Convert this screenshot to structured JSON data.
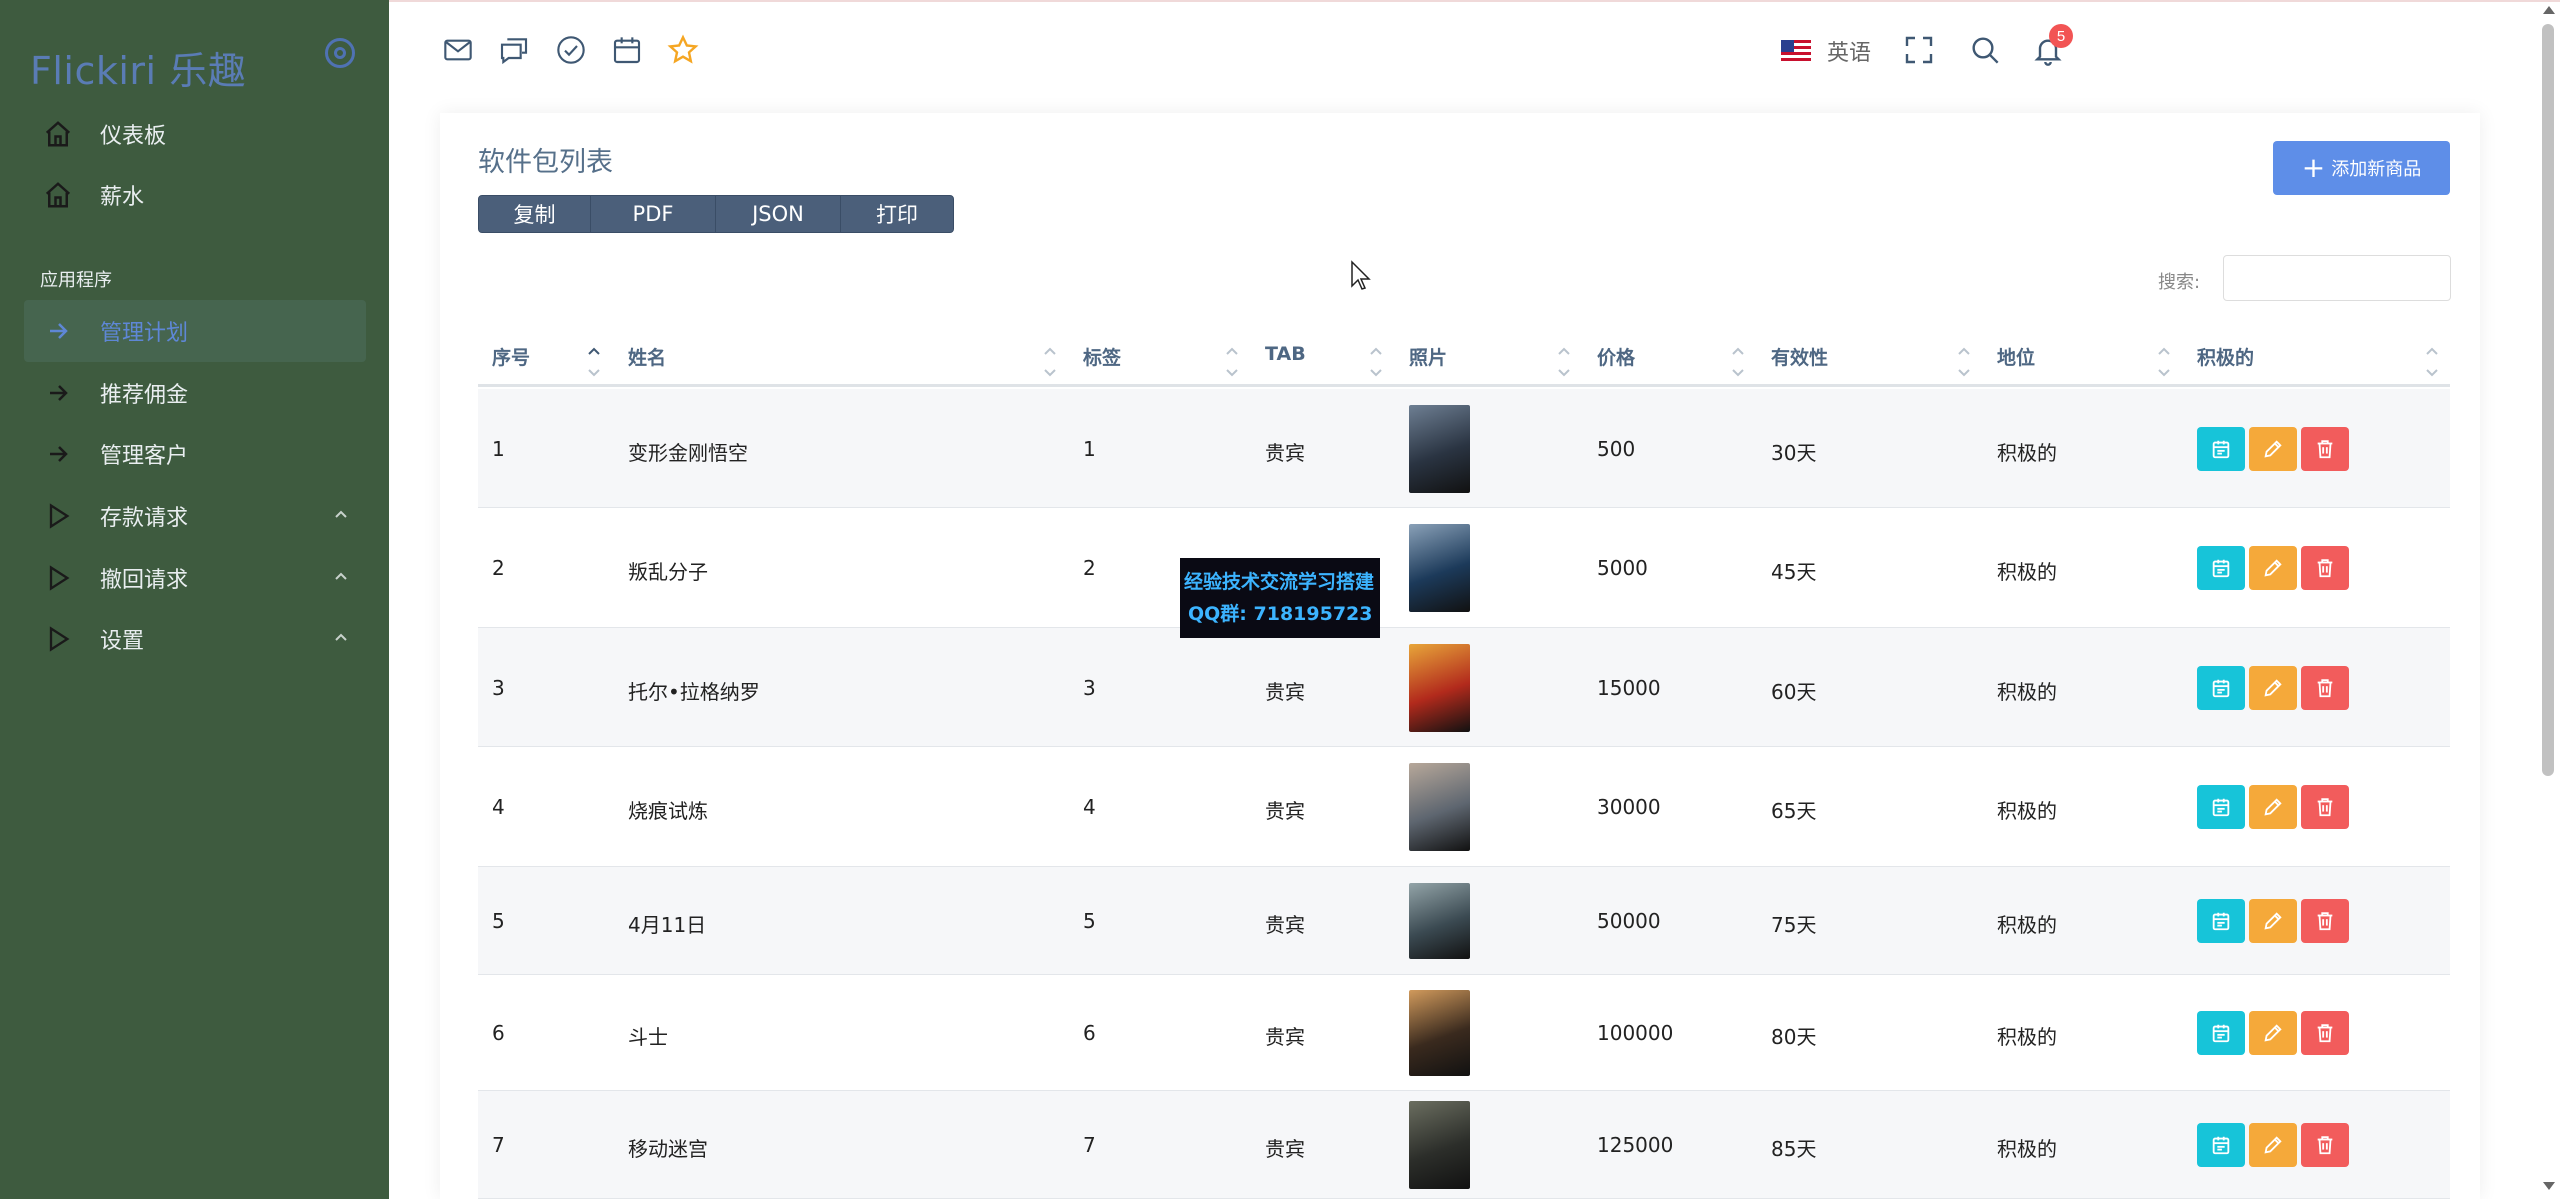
{
  "brand": "Flickiri 乐趣",
  "sidebar": {
    "items": [
      {
        "label": "仪表板",
        "icon": "home-icon"
      },
      {
        "label": "薪水",
        "icon": "home-icon"
      }
    ],
    "section_label": "应用程序",
    "app_items": [
      {
        "label": "管理计划",
        "icon": "arrow-right-icon",
        "active": true
      },
      {
        "label": "推荐佣金",
        "icon": "arrow-right-icon"
      },
      {
        "label": "管理客户",
        "icon": "arrow-right-icon"
      },
      {
        "label": "存款请求",
        "icon": "play-icon",
        "expandable": true
      },
      {
        "label": "撤回请求",
        "icon": "play-icon",
        "expandable": true
      },
      {
        "label": "设置",
        "icon": "play-icon",
        "expandable": true
      }
    ]
  },
  "topbar": {
    "icons": [
      "mail-icon",
      "chat-icon",
      "check-circle-icon",
      "calendar-icon",
      "star-icon"
    ],
    "language": "英语",
    "notification_count": "5"
  },
  "page": {
    "title": "软件包列表",
    "export_buttons": [
      "复制",
      "PDF",
      "JSON",
      "打印"
    ],
    "add_button": "添加新商品",
    "search_label": "搜索:"
  },
  "table": {
    "columns": [
      "序号",
      "姓名",
      "标签",
      "TAB",
      "照片",
      "价格",
      "有效性",
      "地位",
      "积极的"
    ],
    "rows": [
      {
        "id": "1",
        "name": "变形金刚悟空",
        "tag": "1",
        "tab": "贵宾",
        "price": "500",
        "validity": "30天",
        "status": "积极的"
      },
      {
        "id": "2",
        "name": "叛乱分子",
        "tag": "2",
        "tab": "",
        "price": "5000",
        "validity": "45天",
        "status": "积极的"
      },
      {
        "id": "3",
        "name": "托尔•拉格纳罗",
        "tag": "3",
        "tab": "贵宾",
        "price": "15000",
        "validity": "60天",
        "status": "积极的"
      },
      {
        "id": "4",
        "name": "烧痕试炼",
        "tag": "4",
        "tab": "贵宾",
        "price": "30000",
        "validity": "65天",
        "status": "积极的"
      },
      {
        "id": "5",
        "name": "4月11日",
        "tag": "5",
        "tab": "贵宾",
        "price": "50000",
        "validity": "75天",
        "status": "积极的"
      },
      {
        "id": "6",
        "name": "斗士",
        "tag": "6",
        "tab": "贵宾",
        "price": "100000",
        "validity": "80天",
        "status": "积极的"
      },
      {
        "id": "7",
        "name": "移动迷宫",
        "tag": "7",
        "tab": "贵宾",
        "price": "125000",
        "validity": "85天",
        "status": "积极的"
      }
    ]
  },
  "watermark": {
    "line1": "经验技术交流学习搭建",
    "line2": "QQ群: 718195723"
  },
  "colors": {
    "sidebar_bg": "#3e5b3f",
    "accent": "#5e8ee8",
    "view": "#17c4d9",
    "edit": "#f5a93a",
    "delete": "#f25c5c"
  }
}
